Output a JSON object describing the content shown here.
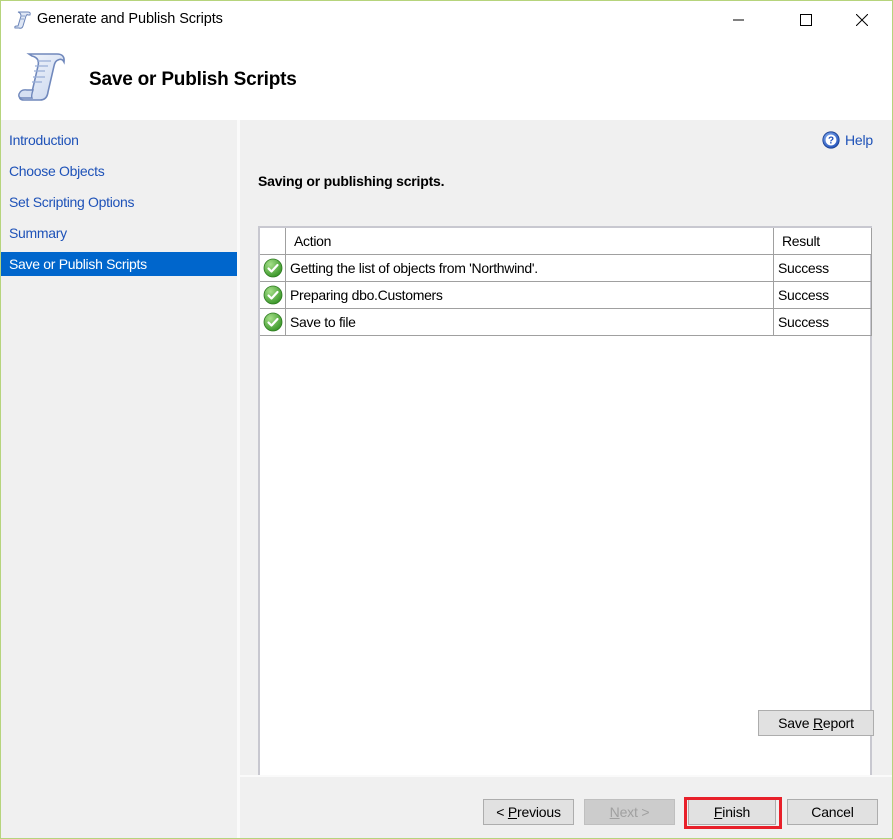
{
  "window": {
    "title": "Generate and Publish Scripts",
    "controls": {
      "minimize": "minimize",
      "maximize": "maximize",
      "close": "close"
    }
  },
  "header": {
    "heading": "Save or Publish Scripts",
    "icon": "script-scroll-icon"
  },
  "sidebar": {
    "items": [
      {
        "label": "Introduction",
        "active": false
      },
      {
        "label": "Choose Objects",
        "active": false
      },
      {
        "label": "Set Scripting Options",
        "active": false
      },
      {
        "label": "Summary",
        "active": false
      },
      {
        "label": "Save or Publish Scripts",
        "active": true
      }
    ]
  },
  "content": {
    "help_label": "Help",
    "subheading": "Saving or publishing scripts.",
    "table": {
      "columns": [
        "",
        "Action",
        "Result"
      ],
      "rows": [
        {
          "status_icon": "success-check-icon",
          "action": "Getting the list of objects from 'Northwind'.",
          "result": "Success"
        },
        {
          "status_icon": "success-check-icon",
          "action": "Preparing dbo.Customers",
          "result": "Success"
        },
        {
          "status_icon": "success-check-icon",
          "action": "Save to file",
          "result": "Success"
        }
      ]
    },
    "save_report": {
      "pre": "Save ",
      "accel": "R",
      "post": "eport"
    }
  },
  "footer": {
    "previous": {
      "pre": "< ",
      "accel": "P",
      "post": "revious",
      "enabled": true
    },
    "next": {
      "pre": "",
      "accel": "N",
      "post": "ext >",
      "enabled": false
    },
    "finish": {
      "pre": "",
      "accel": "F",
      "post": "inish",
      "enabled": true,
      "highlighted": true
    },
    "cancel": {
      "label": "Cancel",
      "enabled": true
    }
  },
  "colors": {
    "accent": "#0066cc",
    "link": "#1e52b8",
    "highlight_border": "#e8202a",
    "window_border": "#b6d47c",
    "success": "#4caf3a"
  }
}
